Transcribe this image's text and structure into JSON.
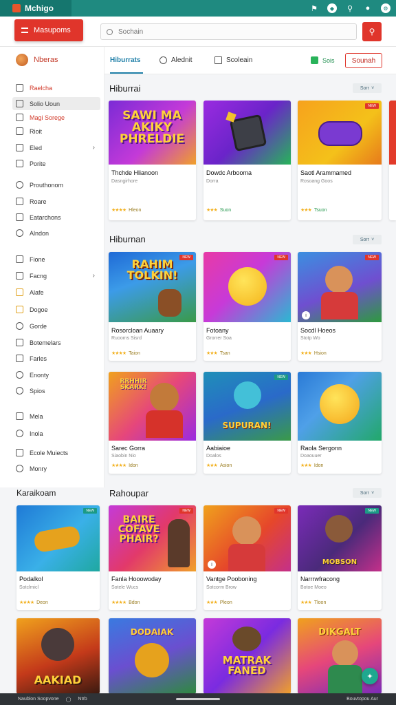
{
  "topbar": {
    "brand": "Mchigo",
    "icons": [
      "pin-icon",
      "shield-icon",
      "search-icon",
      "user-icon",
      "settings-icon"
    ]
  },
  "menu_button": {
    "label": "Masupoms"
  },
  "search": {
    "placeholder": "Sochain"
  },
  "profile": {
    "name": "Nberas"
  },
  "sidebar": {
    "items": [
      {
        "label": "Raelcha",
        "icon": "home-icon"
      },
      {
        "label": "Solio Uoun",
        "icon": "grid-icon"
      },
      {
        "label": "Magi Sorege",
        "icon": "mail-icon"
      },
      {
        "label": "Rioit",
        "icon": "document-icon"
      },
      {
        "label": "Eled",
        "icon": "folder-icon"
      },
      {
        "label": "Porite",
        "icon": "chart-icon"
      },
      {
        "label": "Prouthonom",
        "icon": "heart-icon"
      },
      {
        "label": "Roare",
        "icon": "list-icon"
      },
      {
        "label": "Eatarchons",
        "icon": "image-icon"
      },
      {
        "label": "Alndon",
        "icon": "clock-icon"
      },
      {
        "label": "Fione",
        "icon": "phone-icon"
      },
      {
        "label": "Facng",
        "icon": "tag-icon"
      },
      {
        "label": "Alafe",
        "icon": "star-icon"
      },
      {
        "label": "Dogoe",
        "icon": "award-icon"
      },
      {
        "label": "Gorde",
        "icon": "smile-icon"
      },
      {
        "label": "Botemelars",
        "icon": "people-icon"
      },
      {
        "label": "Farles",
        "icon": "flag-icon"
      },
      {
        "label": "Enonty",
        "icon": "globe-icon"
      },
      {
        "label": "Spios",
        "icon": "cog-icon"
      },
      {
        "label": "Mela",
        "icon": "music-icon"
      },
      {
        "label": "Inola",
        "icon": "info-icon"
      },
      {
        "label": "Ecole Muiects",
        "icon": "book-icon"
      },
      {
        "label": "Monry",
        "icon": "wallet-icon"
      }
    ]
  },
  "tabs": [
    {
      "label": "Hiburrats"
    },
    {
      "label": "Alednit"
    },
    {
      "label": "Scoleain"
    }
  ],
  "green_pill": "Sois",
  "outline_button": "Sounah",
  "sections": [
    {
      "title": "Hiburrai",
      "sort": "Sorr"
    },
    {
      "title": "Hiburnan",
      "sort": "Sorr"
    },
    {
      "title": "Rahoupar",
      "sort": "Sorr"
    }
  ],
  "left_section": {
    "title": "Karaikoam"
  },
  "cards": [
    {
      "title": "Thchde Hlianoon",
      "sub": "Dasngirhore",
      "rating": "Hleon",
      "thumb_text": "SAWI MA\nAKIKY\nPHRELDIE"
    },
    {
      "title": "Dowdc Arbooma",
      "sub": "Dorra",
      "rating": "Suon"
    },
    {
      "title": "Saotl Arammamed",
      "sub": "Rosoang Goos",
      "rating": "Tsuon"
    },
    {
      "title": "Rosorcloan Auaary",
      "sub": "Ruooms Sisrd",
      "rating": "Taion",
      "thumb_text": "RAHIM\nTOLKIN!"
    },
    {
      "title": "Fotoany",
      "sub": "Grorrer Soa",
      "rating": "Tsan"
    },
    {
      "title": "Socdl Hoeos",
      "sub": "Stotp Wo",
      "rating": "Hsion"
    },
    {
      "title": "Sarec Gorra",
      "sub": "Siaobin Nio",
      "rating": "Idon",
      "thumb_text": "RRHHIR\nSKARK!"
    },
    {
      "title": "Aabiaioe",
      "sub": "Doalos",
      "rating": "Asion",
      "thumb_text": "SUPURAN!"
    },
    {
      "title": "Raola Sergonn",
      "sub": "Doaouuer",
      "rating": "Idon"
    },
    {
      "title": "Podalkol",
      "sub": "Sotclmicl",
      "rating": "Deon"
    },
    {
      "title": "Fanla Hooowoday",
      "sub": "Sotele Wucs",
      "rating": "Bdon",
      "thumb_text": "BAIRE\nCOFAVE\nPHAIR?"
    },
    {
      "title": "Vantge Pooboning",
      "sub": "Sotcorm Brow",
      "rating": "Pleon"
    },
    {
      "title": "Narrrwfracong",
      "sub": "Botoe Moeo",
      "rating": "Tloon",
      "thumb_text": "MOBSON"
    },
    {
      "title": "",
      "sub": "",
      "rating": "",
      "thumb_text": "AAKIAD"
    },
    {
      "title": "",
      "sub": "",
      "rating": "",
      "thumb_text": "DODAIAK"
    },
    {
      "title": "",
      "sub": "",
      "rating": "",
      "thumb_text": "MATRAK\nFANED"
    },
    {
      "title": "",
      "sub": "",
      "rating": "",
      "thumb_text": "DIKGALT"
    }
  ],
  "bottombar": {
    "left": "Naublon Soopvone",
    "mid": "Ntrb",
    "right": "Bouvtopou Aur"
  },
  "colors": {
    "brand_teal": "#1f8a80",
    "accent_red": "#e0352b",
    "link_blue": "#1f7fa8"
  }
}
